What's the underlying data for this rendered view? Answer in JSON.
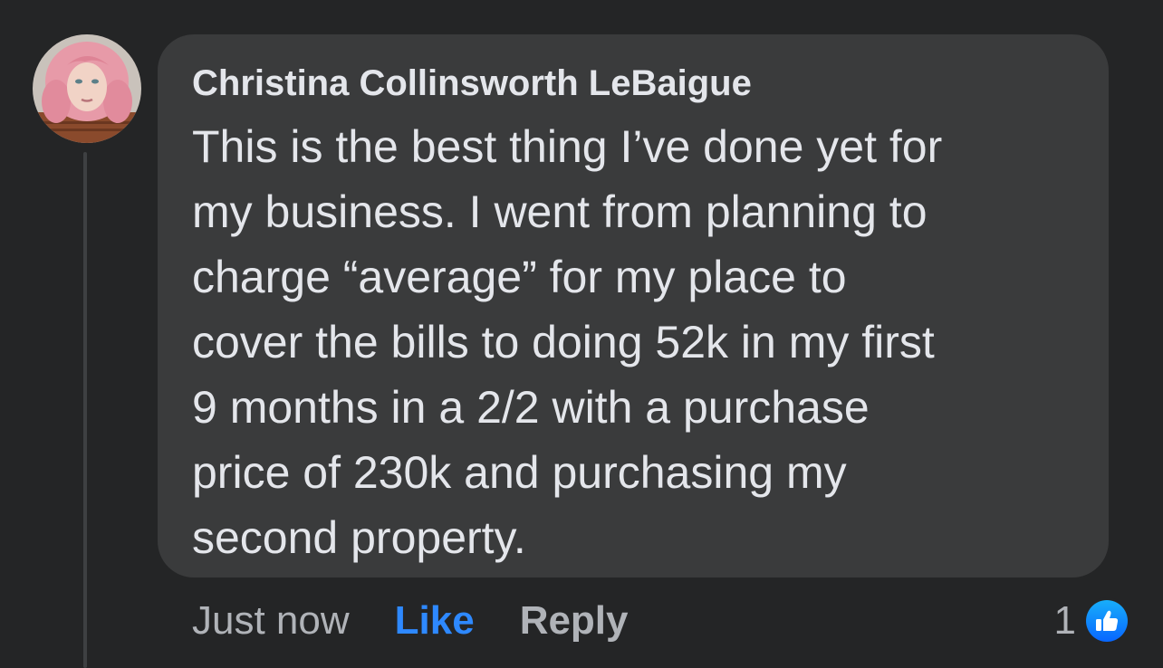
{
  "comment": {
    "author": "Christina Collinsworth LeBaigue",
    "lines": [
      "This is the best thing I’ve done yet for",
      "my business. I went from planning to",
      "charge “average” for my place to",
      "cover the bills to doing 52k in my first",
      "9 months in a 2/2 with a purchase",
      "price of 230k and purchasing my",
      "second property."
    ]
  },
  "actions": {
    "timestamp": "Just now",
    "like_label": "Like",
    "reply_label": "Reply"
  },
  "reactions": {
    "count": "1",
    "icon": "thumbs-up-icon"
  },
  "colors": {
    "background": "#242526",
    "bubble": "#3a3b3c",
    "primary_text": "#e4e6eb",
    "secondary_text": "#b0b3b8",
    "like_accent": "#2e89ff"
  }
}
